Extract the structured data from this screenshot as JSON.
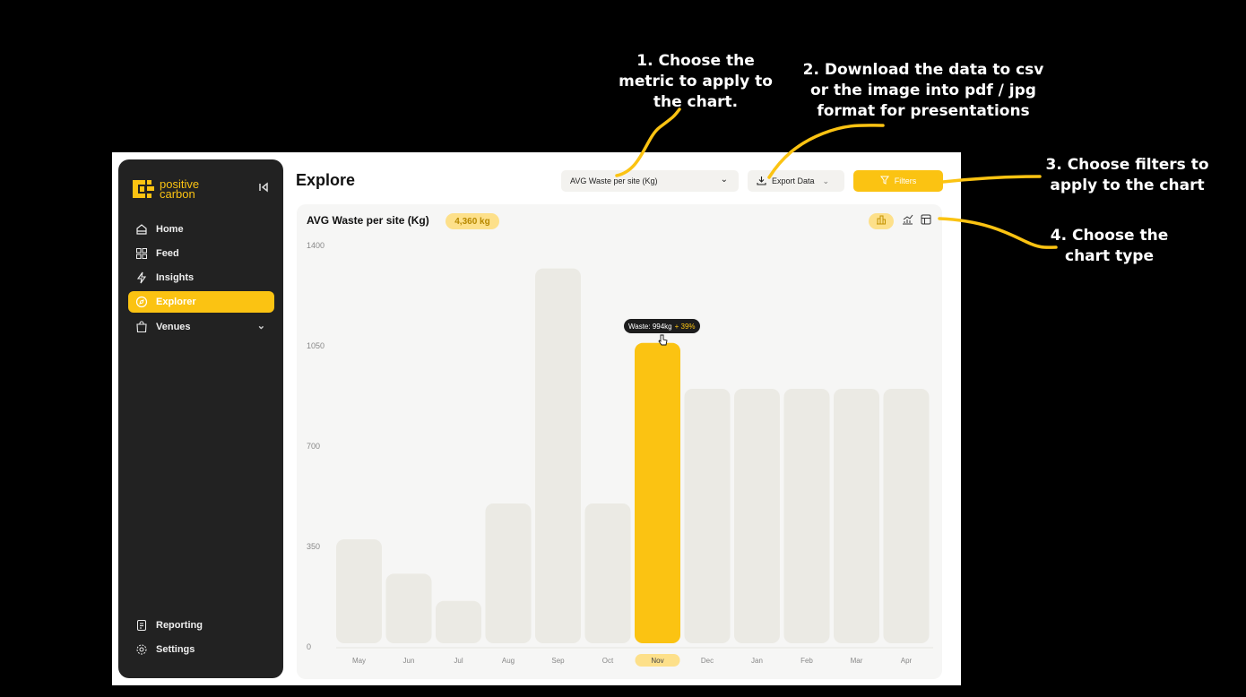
{
  "annotations": [
    {
      "id": "a1",
      "lines": [
        "1. Choose the",
        "metric to apply to",
        "the chart."
      ]
    },
    {
      "id": "a2",
      "lines": [
        "2. Download the data to csv",
        "or the image into pdf / jpg",
        "format for presentations"
      ]
    },
    {
      "id": "a3",
      "lines": [
        "3. Choose filters to",
        "apply to the chart"
      ]
    },
    {
      "id": "a4",
      "lines": [
        "4. Choose the",
        "chart type"
      ]
    }
  ],
  "brand": {
    "line1": "positive",
    "line2": "carbon",
    "accent": "#fbc312"
  },
  "sidebar": {
    "items": [
      {
        "label": "Home",
        "icon": "home-icon"
      },
      {
        "label": "Feed",
        "icon": "grid-icon"
      },
      {
        "label": "Insights",
        "icon": "lightning-icon"
      },
      {
        "label": "Explorer",
        "icon": "compass-icon",
        "active": true
      },
      {
        "label": "Venues",
        "icon": "bag-icon",
        "expandable": true
      }
    ],
    "bottom": [
      {
        "label": "Reporting",
        "icon": "report-icon"
      },
      {
        "label": "Settings",
        "icon": "gear-icon"
      }
    ]
  },
  "header": {
    "title": "Explore",
    "metric_select": "AVG Waste per site (Kg)",
    "export_label": "Export Data",
    "filters_label": "Filters"
  },
  "panel": {
    "title": "AVG Waste per site (Kg)",
    "badge": "4,360 kg"
  },
  "tooltip": {
    "text": "Waste: 994kg",
    "delta": "+ 39%"
  },
  "chart_data": {
    "type": "bar",
    "categories": [
      "May",
      "Jun",
      "Jul",
      "Aug",
      "Sep",
      "Oct",
      "Nov",
      "Dec",
      "Jan",
      "Feb",
      "Mar",
      "Apr"
    ],
    "values": [
      375,
      255,
      160,
      500,
      1320,
      500,
      1060,
      900,
      900,
      900,
      900,
      900
    ],
    "highlight_index": 6,
    "yticks": [
      0,
      350,
      700,
      1050,
      1400
    ],
    "ylim": [
      0,
      1400
    ],
    "colors": {
      "bar": "#ebeae4",
      "highlight": "#fbc312"
    }
  }
}
